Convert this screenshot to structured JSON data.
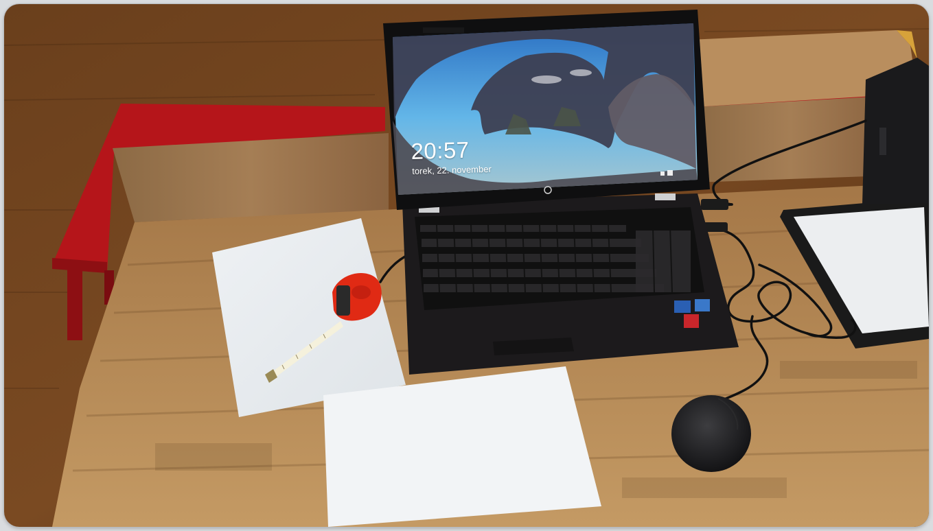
{
  "lock_screen": {
    "time": "20:57",
    "date": "torek, 22. november"
  },
  "colors": {
    "wood_dark": "#5a3518",
    "wood_light": "#b88a55",
    "red_shelf": "#b5151a",
    "laptop_body": "#1c1a1c",
    "paper": "#f3f5f7",
    "tape_measure": "#e02a14",
    "sky": "#3b8fd6"
  },
  "icons": [
    "brand-logo-icon",
    "network-icon",
    "power-icon",
    "intel-sticker-icon",
    "windows-sticker-icon"
  ]
}
